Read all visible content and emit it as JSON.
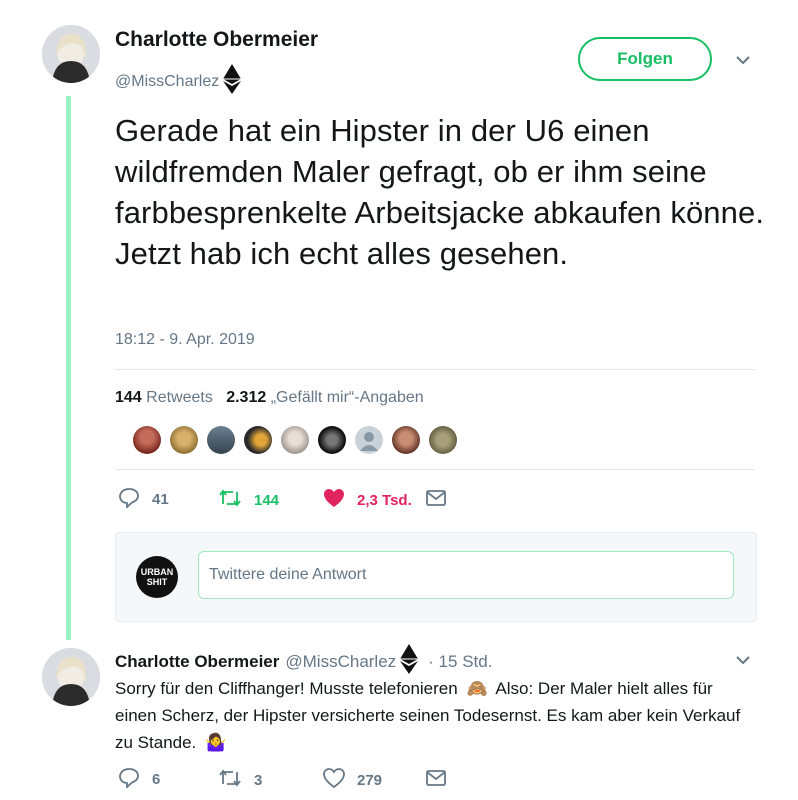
{
  "main_tweet": {
    "author_name": "Charlotte Obermeier",
    "handle": "@MissCharlez",
    "follow_label": "Folgen",
    "text": "Gerade hat ein Hipster in der U6 einen wildfremden Maler gefragt, ob er ihm seine farbbesprenkelte Arbeitsjacke abkaufen könne. Jetzt hab ich echt alles gesehen.",
    "timestamp": "18:12 - 9. Apr. 2019",
    "retweet_count": "144",
    "retweet_label": "Retweets",
    "like_count": "2.312",
    "like_label": "„Gefällt mir“-Angaben",
    "actions": {
      "replies": "41",
      "retweets": "144",
      "likes": "2,3 Tsd."
    }
  },
  "reply_box": {
    "avatar_text": "URBAN SHIT",
    "placeholder": "Twittere deine Antwort"
  },
  "reply_tweet": {
    "author_name": "Charlotte Obermeier",
    "handle": "@MissCharlez",
    "time": "· 15 Std.",
    "text_part1": "Sorry für den Cliffhanger! Musste telefonieren",
    "text_part2": "Also: Der Maler hielt alles für einen Scherz, der Hipster versicherte seinen Todesernst. Es kam aber kein Verkauf zu Stande.",
    "emoji1": "🙈",
    "emoji2": "🤷‍♀️",
    "actions": {
      "replies": "6",
      "retweets": "3",
      "likes": "279"
    }
  },
  "colors": {
    "accent_green": "#17bf63",
    "like_red": "#e0245e",
    "secondary_text": "#657786",
    "thread_line": "#9af2c4"
  },
  "icons": [
    "ethereum-icon",
    "chevron-down-icon",
    "reply-icon",
    "retweet-icon",
    "heart-icon",
    "message-icon"
  ]
}
